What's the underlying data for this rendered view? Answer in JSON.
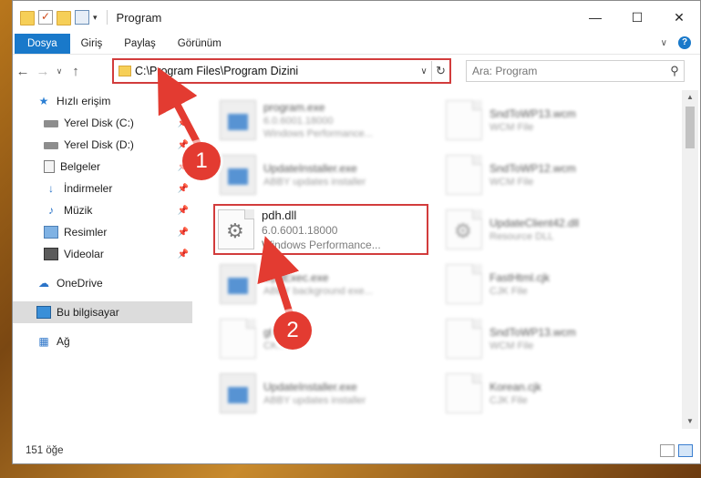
{
  "window": {
    "title": "Program",
    "controls": {
      "minimize": "—",
      "maximize": "☐",
      "close": "✕"
    }
  },
  "ribbon": {
    "tabs": [
      "Dosya",
      "Giriş",
      "Paylaş",
      "Görünüm"
    ],
    "help": "?"
  },
  "nav": {
    "address": "C:\\Program Files\\Program Dizini",
    "search_placeholder": "Ara: Program"
  },
  "sidebar": {
    "items": [
      {
        "label": "Hızlı erişim",
        "icon": "star-icon",
        "pinned": false
      },
      {
        "label": "Yerel Disk (C:)",
        "icon": "disk-icon",
        "pinned": true
      },
      {
        "label": "Yerel Disk (D:)",
        "icon": "disk-icon",
        "pinned": true
      },
      {
        "label": "Belgeler",
        "icon": "documents-icon",
        "pinned": true
      },
      {
        "label": "İndirmeler",
        "icon": "download-icon",
        "pinned": true
      },
      {
        "label": "Müzik",
        "icon": "music-icon",
        "pinned": true
      },
      {
        "label": "Resimler",
        "icon": "pictures-icon",
        "pinned": true
      },
      {
        "label": "Videolar",
        "icon": "videos-icon",
        "pinned": true
      },
      {
        "label": "OneDrive",
        "icon": "cloud-icon",
        "pinned": false
      },
      {
        "label": "Bu bilgisayar",
        "icon": "computer-icon",
        "pinned": false,
        "selected": true
      },
      {
        "label": "Ağ",
        "icon": "network-icon",
        "pinned": false
      }
    ]
  },
  "files": {
    "left": [
      {
        "name": "program.exe",
        "line2": "6.0.6001.18000",
        "line3": "Windows Performance..."
      },
      {
        "name": "UpdateInstaller.exe",
        "line2": "ABBY updates installer",
        "line3": ""
      },
      {
        "name": "UpdExec.exe",
        "line2": "ABBY background exe...",
        "line3": ""
      },
      {
        "name": "ghl...",
        "line2": "CK...",
        "line3": ""
      },
      {
        "name": "UpdateInstaller.exe",
        "line2": "ABBY updates installer",
        "line3": ""
      }
    ],
    "right": [
      {
        "name": "SndToWP13.wcm",
        "line2": "WCM File"
      },
      {
        "name": "SndToWP12.wcm",
        "line2": "WCM File"
      },
      {
        "name": "UpdateClient42.dll",
        "line2": "Resource DLL"
      },
      {
        "name": "FastHtml.cjk",
        "line2": "CJK File"
      },
      {
        "name": "SndToWP13.wcm",
        "line2": "WCM File"
      },
      {
        "name": "Korean.cjk",
        "line2": "CJK File"
      }
    ],
    "highlighted": {
      "name": "pdh.dll",
      "version": "6.0.6001.18000",
      "description": "Windows Performance..."
    }
  },
  "status": {
    "count": "151 öğe"
  },
  "callouts": {
    "one": "1",
    "two": "2"
  },
  "colors": {
    "accent": "#1979ca",
    "highlight": "#d23c3c"
  }
}
